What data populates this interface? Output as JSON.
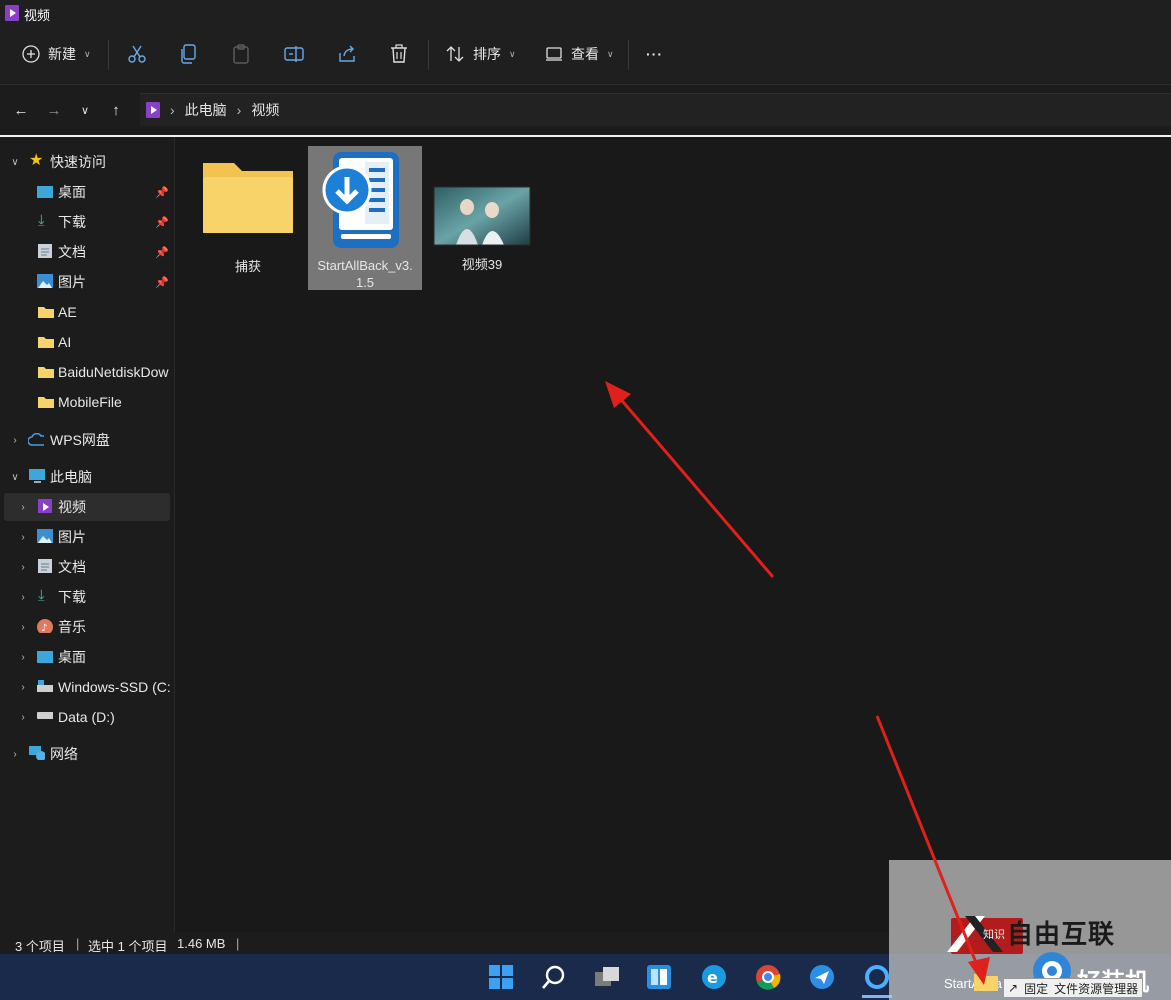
{
  "window": {
    "title": "视频"
  },
  "toolbar": {
    "new_label": "新建",
    "sort_label": "排序",
    "view_label": "查看",
    "more_label": "···"
  },
  "address": {
    "crumbs": [
      "此电脑",
      "视频"
    ],
    "separator": "›"
  },
  "sidebar": {
    "quick_access": "快速访问",
    "quick_items": [
      "桌面",
      "下载",
      "文档",
      "图片",
      "AE",
      "AI",
      "BaiduNetdiskDow",
      "MobileFile"
    ],
    "wps": "WPS网盘",
    "this_pc": "此电脑",
    "pc_items": [
      "视频",
      "图片",
      "文档",
      "下载",
      "音乐",
      "桌面",
      "Windows-SSD (C:)",
      "Data (D:)"
    ],
    "network": "网络"
  },
  "files": [
    {
      "name": "捕获",
      "type": "folder"
    },
    {
      "name": "StartAllBack_v3.1.5",
      "name_line1": "StartAllBack_v3.",
      "name_line2": "1.5",
      "type": "installer",
      "selected": true
    },
    {
      "name": "视频39",
      "type": "video"
    }
  ],
  "status": {
    "count": "3 个项目",
    "selected": "选中 1 个项目",
    "size": "1.46 MB"
  },
  "taskbar": {
    "tooltip": "StartAllBa",
    "pin_hint": "固定",
    "pin_target": "文件资源管理器"
  },
  "watermark": {
    "brand1": "自由互联",
    "brand2": "好装机",
    "small": "知识"
  },
  "colors": {
    "background": "#191919",
    "selection": "#777777",
    "accent_red": "#e0201b",
    "taskbar": "#1a2a4a",
    "folder_yellow": "#f8d36a"
  }
}
